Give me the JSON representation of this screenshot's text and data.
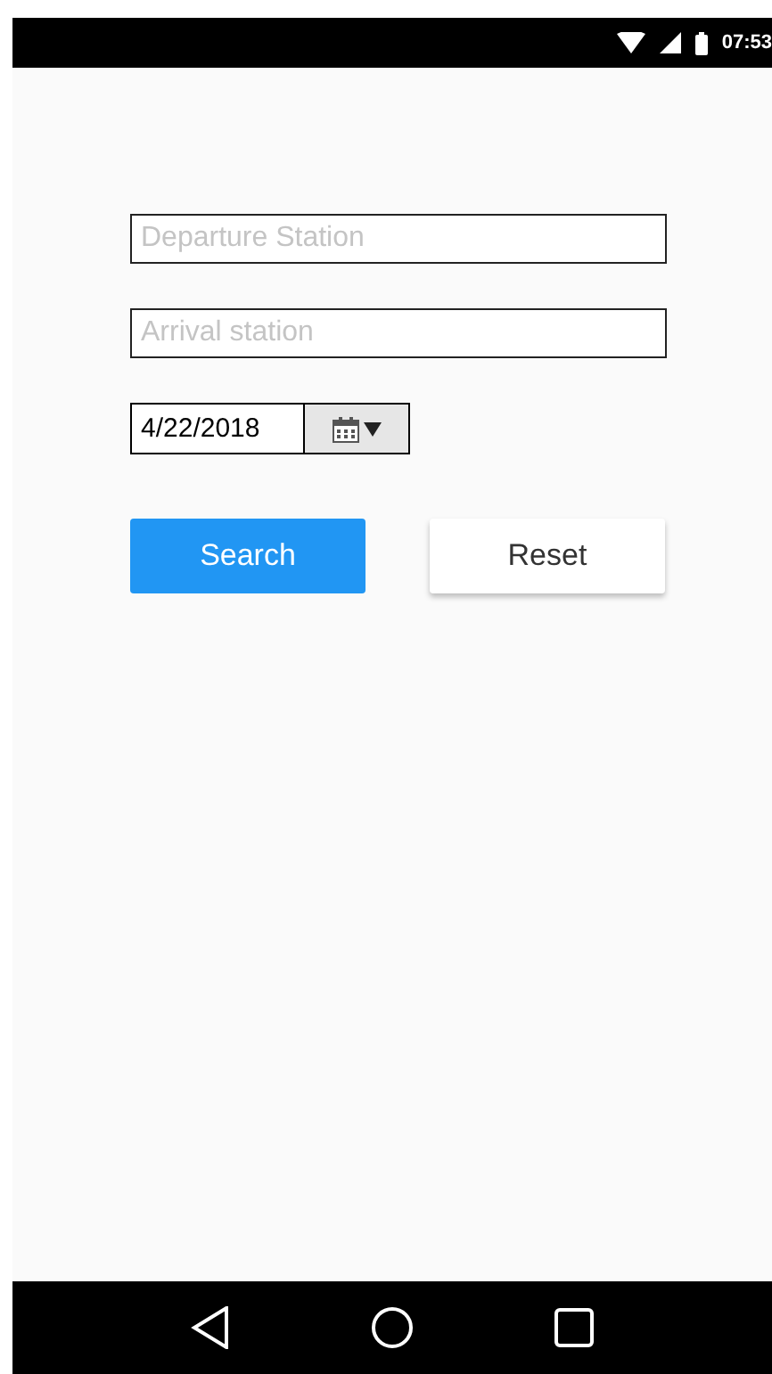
{
  "status_bar": {
    "time": "07:53"
  },
  "form": {
    "departure": {
      "placeholder": "Departure Station"
    },
    "arrival": {
      "placeholder": "Arrival station"
    },
    "date": {
      "value": "4/22/2018"
    }
  },
  "buttons": [
    {
      "label": "Search",
      "kind": "primary"
    },
    {
      "label": "Reset",
      "kind": "secondary"
    }
  ]
}
